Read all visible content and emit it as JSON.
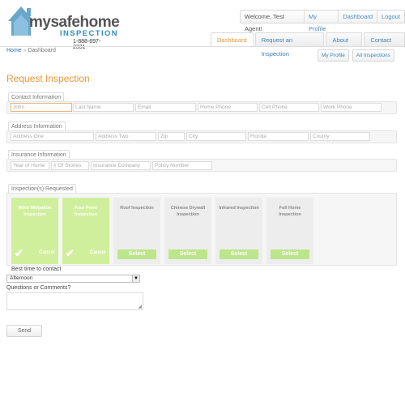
{
  "logo": {
    "word": "mysafehome",
    "sub": "INSPECTION",
    "phone": "1-888-697-2331"
  },
  "userbar": {
    "welcome": "Welcome, Test Agent!",
    "links": [
      "My Profile",
      "Dashboard",
      "Logout"
    ]
  },
  "tabs": [
    {
      "label": "Dashboard",
      "active": true
    },
    {
      "label": "Request an Inspection",
      "active": false
    },
    {
      "label": "About Us",
      "active": false
    },
    {
      "label": "Contact Us",
      "active": false
    }
  ],
  "breadcrumb": {
    "home": "Home",
    "separator": "»",
    "current": "Dashboard"
  },
  "subnav": [
    "My Profile",
    "All Inspections"
  ],
  "page_title": "Request Inspection",
  "contact": {
    "legend": "Contact Information",
    "fields": [
      "John",
      "Last Name",
      "Email",
      "Home Phone",
      "Cell Phone",
      "Work Phone"
    ]
  },
  "address": {
    "legend": "Address Information",
    "fields": [
      "Address One",
      "Address Two",
      "Zip",
      "City",
      "Florida",
      "County"
    ]
  },
  "insurance": {
    "legend": "Insurance Information",
    "fields": [
      "Year of Home",
      "# Of Stories",
      "Insurance Company",
      "Policy Number"
    ]
  },
  "inspections": {
    "legend": "Inspection(s) Requested",
    "cancel_label": "Cancel",
    "select_label": "Select",
    "items": [
      {
        "title": "Wind Mitigation Inspection",
        "selected": true
      },
      {
        "title": "Four Point Inspection",
        "selected": true
      },
      {
        "title": "Roof Inspection",
        "selected": false
      },
      {
        "title": "Chinese Drywall Inspection",
        "selected": false
      },
      {
        "title": "Infrared Inspection",
        "selected": false
      },
      {
        "title": "Full Home Inspection",
        "selected": false
      }
    ]
  },
  "best_time": {
    "label": "Best time to contact",
    "value": "Afternoon"
  },
  "comments": {
    "label": "Questions or Comments?"
  },
  "send_label": "Send",
  "colors": {
    "accent": "#e8973a",
    "link": "#3d80b8",
    "selected_card": "#d0ef9c",
    "select_button": "#bde58a"
  }
}
